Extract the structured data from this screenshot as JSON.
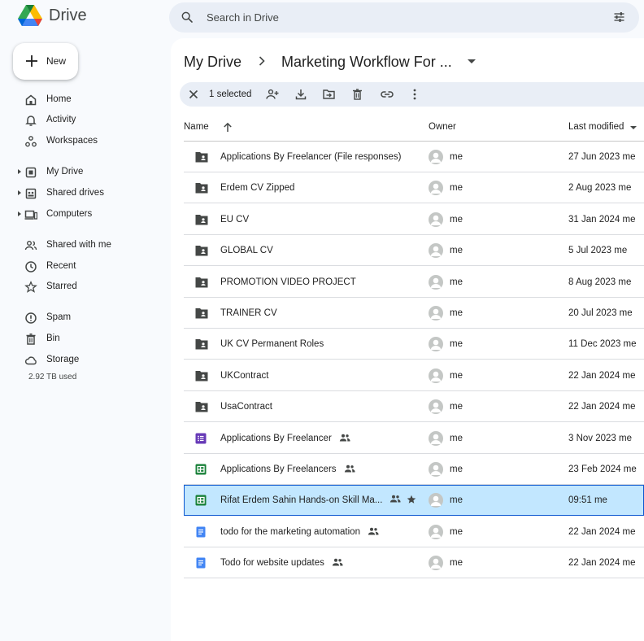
{
  "app": {
    "name": "Drive"
  },
  "search": {
    "placeholder": "Search in Drive"
  },
  "new_button": {
    "label": "New"
  },
  "sidebar": {
    "items": [
      {
        "label": "Home"
      },
      {
        "label": "Activity"
      },
      {
        "label": "Workspaces"
      },
      {
        "label": "My Drive"
      },
      {
        "label": "Shared drives"
      },
      {
        "label": "Computers"
      },
      {
        "label": "Shared with me"
      },
      {
        "label": "Recent"
      },
      {
        "label": "Starred"
      },
      {
        "label": "Spam"
      },
      {
        "label": "Bin"
      },
      {
        "label": "Storage"
      }
    ],
    "storage_used": "2.92 TB used"
  },
  "breadcrumb": {
    "root": "My Drive",
    "current": "Marketing Workflow For ..."
  },
  "selection": {
    "count_label": "1 selected"
  },
  "table": {
    "headers": {
      "name": "Name",
      "owner": "Owner",
      "modified": "Last modified"
    },
    "rows": [
      {
        "name": "Applications By Freelancer (File responses)",
        "type": "shared-folder",
        "owner": "me",
        "modified": "27 Jun 2023 me"
      },
      {
        "name": "Erdem CV Zipped",
        "type": "shared-folder",
        "owner": "me",
        "modified": "2 Aug 2023 me"
      },
      {
        "name": "EU CV",
        "type": "shared-folder",
        "owner": "me",
        "modified": "31 Jan 2024 me"
      },
      {
        "name": "GLOBAL CV",
        "type": "shared-folder",
        "owner": "me",
        "modified": "5 Jul 2023 me"
      },
      {
        "name": "PROMOTION VIDEO PROJECT",
        "type": "shared-folder",
        "owner": "me",
        "modified": "8 Aug 2023 me"
      },
      {
        "name": "TRAINER CV",
        "type": "shared-folder",
        "owner": "me",
        "modified": "20 Jul 2023 me"
      },
      {
        "name": "UK CV Permanent Roles",
        "type": "shared-folder",
        "owner": "me",
        "modified": "11 Dec 2023 me"
      },
      {
        "name": "UKContract",
        "type": "shared-folder",
        "owner": "me",
        "modified": "22 Jan 2024 me"
      },
      {
        "name": "UsaContract",
        "type": "shared-folder",
        "owner": "me",
        "modified": "22 Jan 2024 me"
      },
      {
        "name": "Applications By Freelancer",
        "type": "form",
        "owner": "me",
        "modified": "3 Nov 2023 me",
        "shared": true
      },
      {
        "name": "Applications By Freelancers",
        "type": "sheet",
        "owner": "me",
        "modified": "23 Feb 2024 me",
        "shared": true
      },
      {
        "name": "Rifat Erdem Sahin Hands-on Skill Ma...",
        "type": "sheet",
        "owner": "me",
        "modified": "09:51 me",
        "shared": true,
        "starred": true,
        "selected": true
      },
      {
        "name": "todo for the marketing automation",
        "type": "doc",
        "owner": "me",
        "modified": "22 Jan 2024 me",
        "shared": true
      },
      {
        "name": "Todo for website updates",
        "type": "doc",
        "owner": "me",
        "modified": "22 Jan 2024 me",
        "shared": true
      }
    ]
  },
  "colors": {
    "background": "#f8fafd",
    "search_bg": "#e9eef6",
    "selected_row": "#c2e7ff",
    "selected_border": "#0b57d0",
    "sheet_green": "#188038",
    "doc_blue": "#4285f4",
    "form_purple": "#673ab7"
  }
}
